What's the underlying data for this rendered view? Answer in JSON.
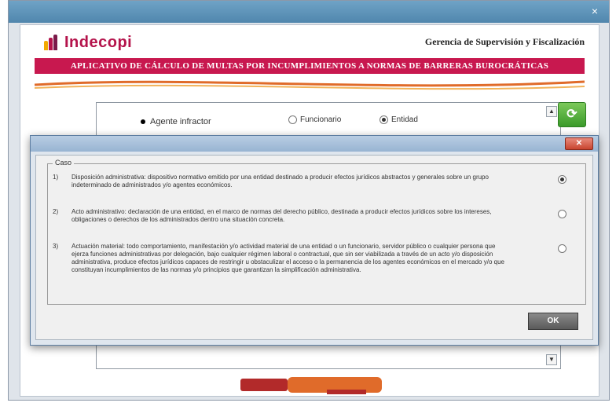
{
  "window": {
    "close_glyph": "×"
  },
  "header": {
    "brand": "Indecopi",
    "subtitle": "Gerencia de Supervisión y Fiscalización",
    "banner": "APLICATIVO DE CÁLCULO DE MULTAS POR INCUMPLIMIENTOS A NORMAS DE BARRERAS BUROCRÁTICAS"
  },
  "main": {
    "agent_label": "Agente infractor",
    "options": [
      {
        "label": "Funcionario",
        "checked": false
      },
      {
        "label": "Entidad",
        "checked": true
      }
    ]
  },
  "dialog": {
    "close_glyph": "✕",
    "legend": "Caso",
    "cases": [
      {
        "num": "1)",
        "text": "Disposición administrativa: dispositivo normativo emitido por una entidad destinado a producir efectos jurídicos abstractos y generales sobre un grupo indeterminado de administrados y/o agentes económicos.",
        "checked": true
      },
      {
        "num": "2)",
        "text": "Acto administrativo: declaración de una entidad, en el marco de normas del derecho público, destinada a producir efectos jurídicos sobre los intereses, obligaciones o derechos de los administrados dentro una situación concreta.",
        "checked": false
      },
      {
        "num": "3)",
        "text": "Actuación material: todo comportamiento, manifestación y/o actividad material de una entidad o un funcionario, servidor público o cualquier persona que ejerza funciones administrativas por delegación, bajo cualquier régimen laboral o contractual, que sin ser viabilizada a través de un acto y/o disposición administrativa, produce efectos jurídicos capaces de restringir u obstaculizar el acceso o la permanencia de los agentes económicos en el mercado y/o que constituyan incumplimientos de las normas y/o principios que garantizan la simplificación administrativa.",
        "checked": false
      }
    ],
    "ok_label": "OK"
  },
  "colors": {
    "brand": "#b4134b",
    "banner": "#c8184f",
    "refresh": "#3a9a2a"
  },
  "icons": {
    "refresh": "refresh-icon",
    "footer": "barreras-logo"
  }
}
